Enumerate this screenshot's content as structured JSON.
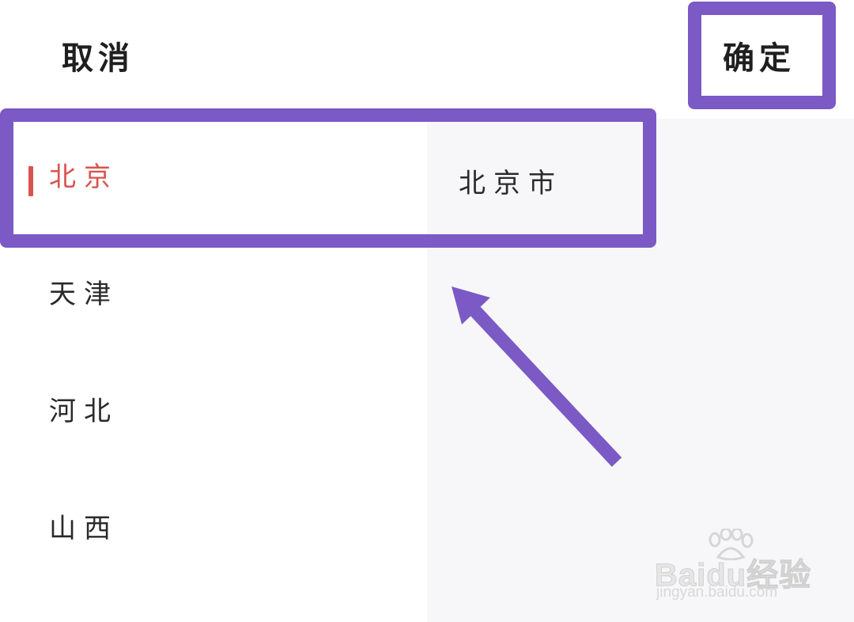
{
  "header": {
    "cancel_label": "取消",
    "confirm_label": "确定"
  },
  "provinces": [
    {
      "label": "北京",
      "selected": true
    },
    {
      "label": "天津",
      "selected": false
    },
    {
      "label": "河北",
      "selected": false
    },
    {
      "label": "山西",
      "selected": false
    }
  ],
  "cities": [
    {
      "label": "北京市"
    }
  ],
  "watermark": {
    "brand": "Baidu经验",
    "url": "jingyan.baidu.com"
  },
  "colors": {
    "accent_selected": "#d9534f",
    "annotation": "#7b5ac6",
    "right_pane_bg": "#f7f7f9",
    "text": "#2a2a2a"
  }
}
